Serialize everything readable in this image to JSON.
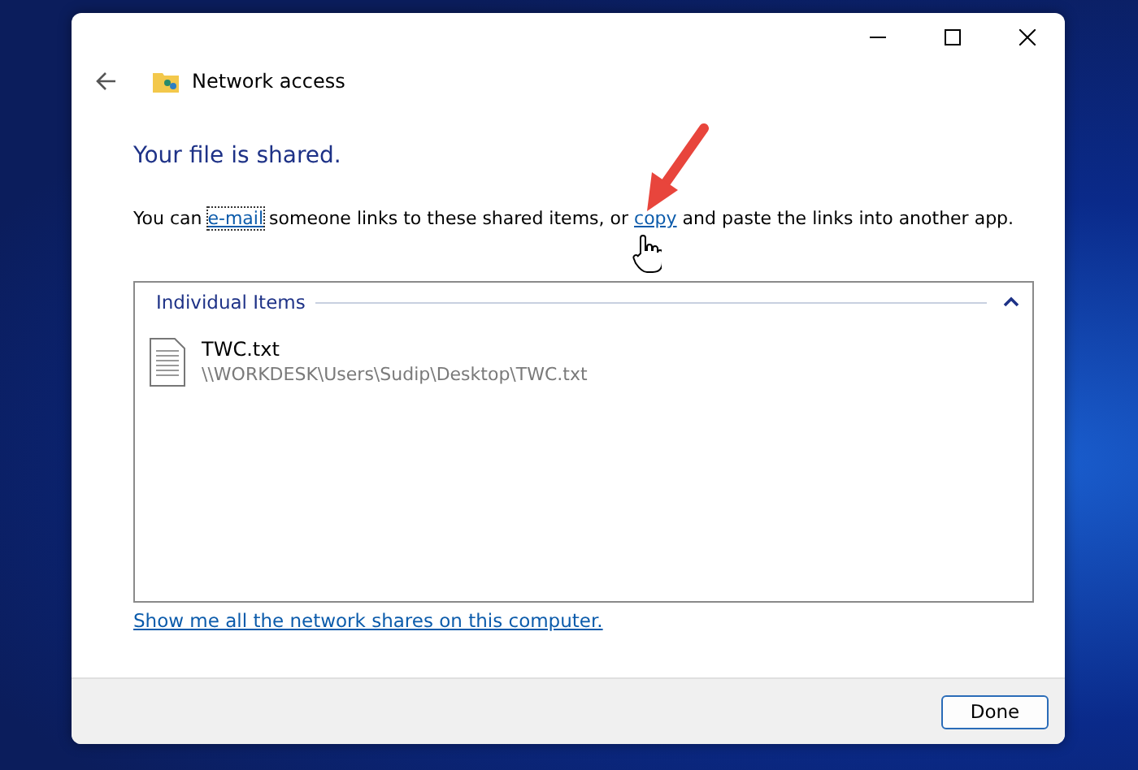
{
  "window": {
    "title": "Network access"
  },
  "heading": "Your file is shared.",
  "sentence": [
    {
      "kind": "text",
      "text": "You can "
    },
    {
      "kind": "link",
      "text": "e-mail",
      "focused": true
    },
    {
      "kind": "text",
      "text": " someone links to these shared items, or "
    },
    {
      "kind": "link",
      "text": "copy",
      "focused": false
    },
    {
      "kind": "text",
      "text": " and paste the links into another app."
    }
  ],
  "group": {
    "label": "Individual Items",
    "expanded": true,
    "items": [
      {
        "name": "TWC.txt",
        "path": "\\\\WORKDESK\\Users\\Sudip\\Desktop\\TWC.txt"
      }
    ]
  },
  "shares_link": "Show me all the network shares on this computer.",
  "buttons": [
    {
      "label": "Done",
      "default": true
    }
  ]
}
